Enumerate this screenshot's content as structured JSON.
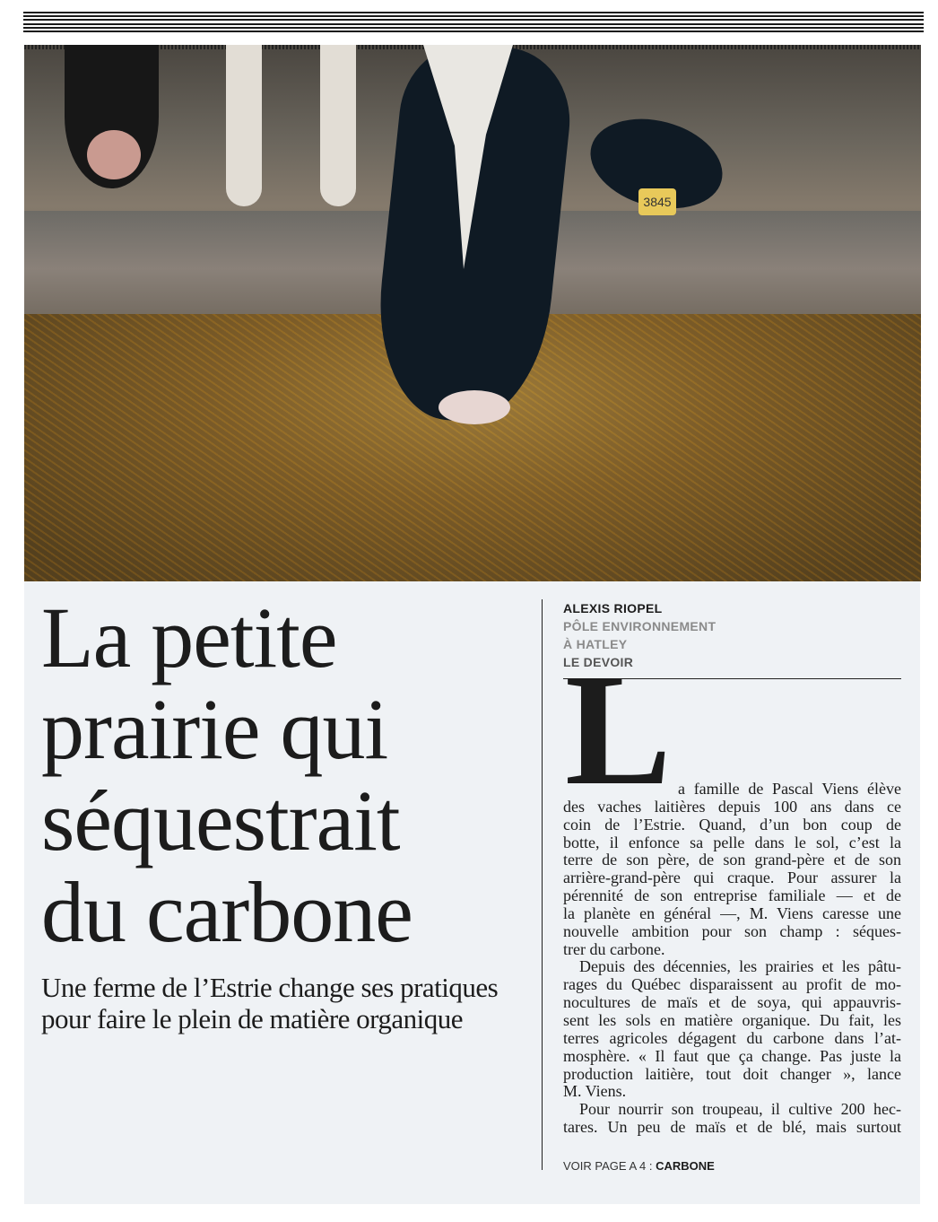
{
  "article": {
    "headline": [
      "La petite",
      "prairie qui",
      "séquestrait",
      "du carbone"
    ],
    "subheadline": [
      "Une ferme de l’Estrie change ses pratiques",
      "pour faire le plein de matière organique"
    ],
    "photo": {
      "ear_tag": "3845"
    },
    "byline": {
      "author": "ALEXIS RIOPEL",
      "desk": "PÔLE ENVIRONNEMENT",
      "location": "À HATLEY",
      "publication": "LE DEVOIR"
    },
    "drop_cap": "L",
    "body_lines": [
      "a famille de Pascal Viens élève",
      "des vaches laitières depuis 100 ans dans ce",
      "coin de l’Estrie. Quand, d’un bon coup de",
      "botte, il enfonce sa pelle dans le sol, c’est la",
      "terre de son père, de son grand-père et de son",
      "arrière-grand-père qui craque. Pour assurer la",
      "pérennité de son entreprise familiale — et de",
      "la planète en général —, M. Viens caresse une",
      "nouvelle ambition pour son champ : séques-",
      "trer du carbone.",
      "Depuis des décennies, les prairies et les pâtu-",
      "rages du Québec disparaissent au profit de mo-",
      "nocultures de maïs et de soya, qui appauvris-",
      "sent les sols en matière organique. Du fait, les",
      "terres agricoles dégagent du carbone dans l’at-",
      "mosphère. « Il faut que ça change. Pas juste la",
      "production laitière, tout doit changer », lance",
      "M. Viens.",
      "Pour nourrir son troupeau, il cultive 200 hec-",
      "tares. Un peu de maïs et de blé, mais surtout"
    ],
    "continuation": {
      "prefix": "VOIR PAGE A 4 :",
      "keyword": "CARBONE"
    }
  }
}
